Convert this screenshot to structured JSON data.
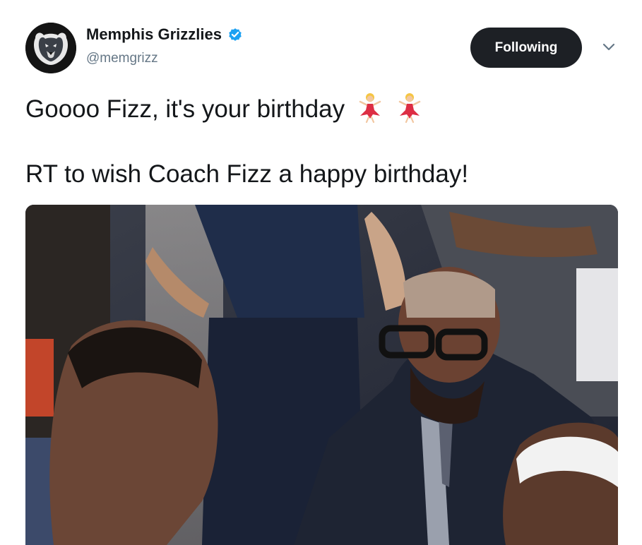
{
  "account": {
    "display_name": "Memphis Grizzlies",
    "handle": "@memgrizz",
    "verified": true,
    "avatar_icon": "grizzly-bear-logo-icon"
  },
  "actions": {
    "follow_label": "Following",
    "more_icon": "chevron-down-icon"
  },
  "tweet": {
    "line1": "Goooo Fizz, it's your birthday",
    "line1_emoji": [
      "dancer-emoji",
      "dancer-emoji"
    ],
    "line2": "RT to wish Coach Fizz a happy birthday!"
  },
  "media": {
    "type": "video-still",
    "subject": "coach-huddle-photo"
  },
  "colors": {
    "verified_blue": "#1da1f2",
    "button_dark": "#1d2025",
    "handle_gray": "#657786"
  }
}
